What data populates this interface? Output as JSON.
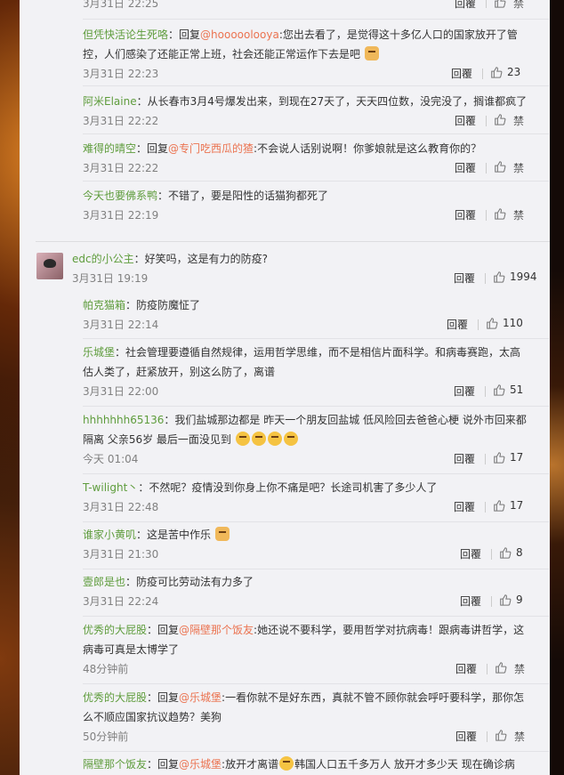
{
  "labels": {
    "reply": "回覆",
    "block": "禁"
  },
  "replies_top": [
    {
      "time": "3月31日 22:25",
      "likes": ""
    },
    {
      "user": "但凭快活论生死咯",
      "prefix": "：回复",
      "mention": "@hooooolooya",
      "text1": ":您出去看了，是觉得这十多亿人口的国家放开了管",
      "text2": "控，人们感染了还能正常上班，社会还能正常运作下去是吧",
      "time": "3月31日 22:23",
      "likes": "23"
    },
    {
      "user": "阿米Elaine",
      "text1": "：从长春市3月4号爆发出来，到现在27天了，天天四位数，没完没了，搁谁都疯了",
      "time": "3月31日 22:22",
      "likes": ""
    },
    {
      "user": "难得的晴空",
      "prefix": "：回复",
      "mention": "@专门吃西瓜的猹",
      "text1": ":不会说人话别说啊！你爹娘就是这么教育你的？",
      "time": "3月31日 22:22",
      "likes": ""
    },
    {
      "user": "今天也要佛系鸭",
      "text1": "：不错了，要是阳性的话猫狗都死了",
      "time": "3月31日 22:19",
      "likes": ""
    }
  ],
  "main_comment": {
    "user": "edc的小公主",
    "text": "：好笑吗，这是有力的防疫?",
    "time": "3月31日 19:19",
    "likes": "1994"
  },
  "sub_replies": [
    {
      "user": "帕克猫箱",
      "text1": "：防疫防魔怔了",
      "time": "3月31日 22:14",
      "likes": "110"
    },
    {
      "user": "乐城堡",
      "text1": "：社会管理要遵循自然规律，运用哲学思维，而不是相信片面科学。和病毒赛跑，太高",
      "text2": "估人类了，赶紧放开，别这么防了，离谱",
      "time": "3月31日 22:00",
      "likes": "51"
    },
    {
      "user": "hhhhhhh65136",
      "text1": "：我们盐城那边都是 昨天一个朋友回盐城 低风险回去爸爸心梗 说外市回来都",
      "text2": "隔离 父亲56岁 最后一面没见到",
      "time": "今天 01:04",
      "likes": "17"
    },
    {
      "user": "T-wilight丶",
      "text1": "：不然呢？疫情没到你身上你不痛是吧？长途司机害了多少人了",
      "time": "3月31日 22:48",
      "likes": "17"
    },
    {
      "user": "谁家小黄叽",
      "text1": "：这是苦中作乐",
      "time": "3月31日 21:30",
      "likes": "8"
    },
    {
      "user": "壹郎是也",
      "text1": "：防疫可比劳动法有力多了",
      "time": "3月31日 22:24",
      "likes": "9"
    },
    {
      "user": "优秀的大屁股",
      "prefix": "：回复",
      "mention": "@隔壁那个饭友",
      "text1": ":她还说不要科学，要用哲学对抗病毒！跟病毒讲哲学，这",
      "text2": "病毒可真是太博学了",
      "time": "48分钟前",
      "likes": ""
    },
    {
      "user": "优秀的大屁股",
      "prefix": "：回复",
      "mention": "@乐城堡",
      "text1": ":一看你就不是好东西，真就不管不顾你就会呼吁要科学，那你怎",
      "text2": "么不顺应国家抗议趋势？美狗",
      "time": "50分钟前",
      "likes": ""
    },
    {
      "user": "隔壁那个饭友",
      "prefix": "：回复",
      "mention": "@乐城堡",
      "text1": ":放开才离谱",
      "text1b": "韩国人口五千多万人 放开才多少天 现在确诊病",
      "time": "",
      "likes": ""
    }
  ]
}
